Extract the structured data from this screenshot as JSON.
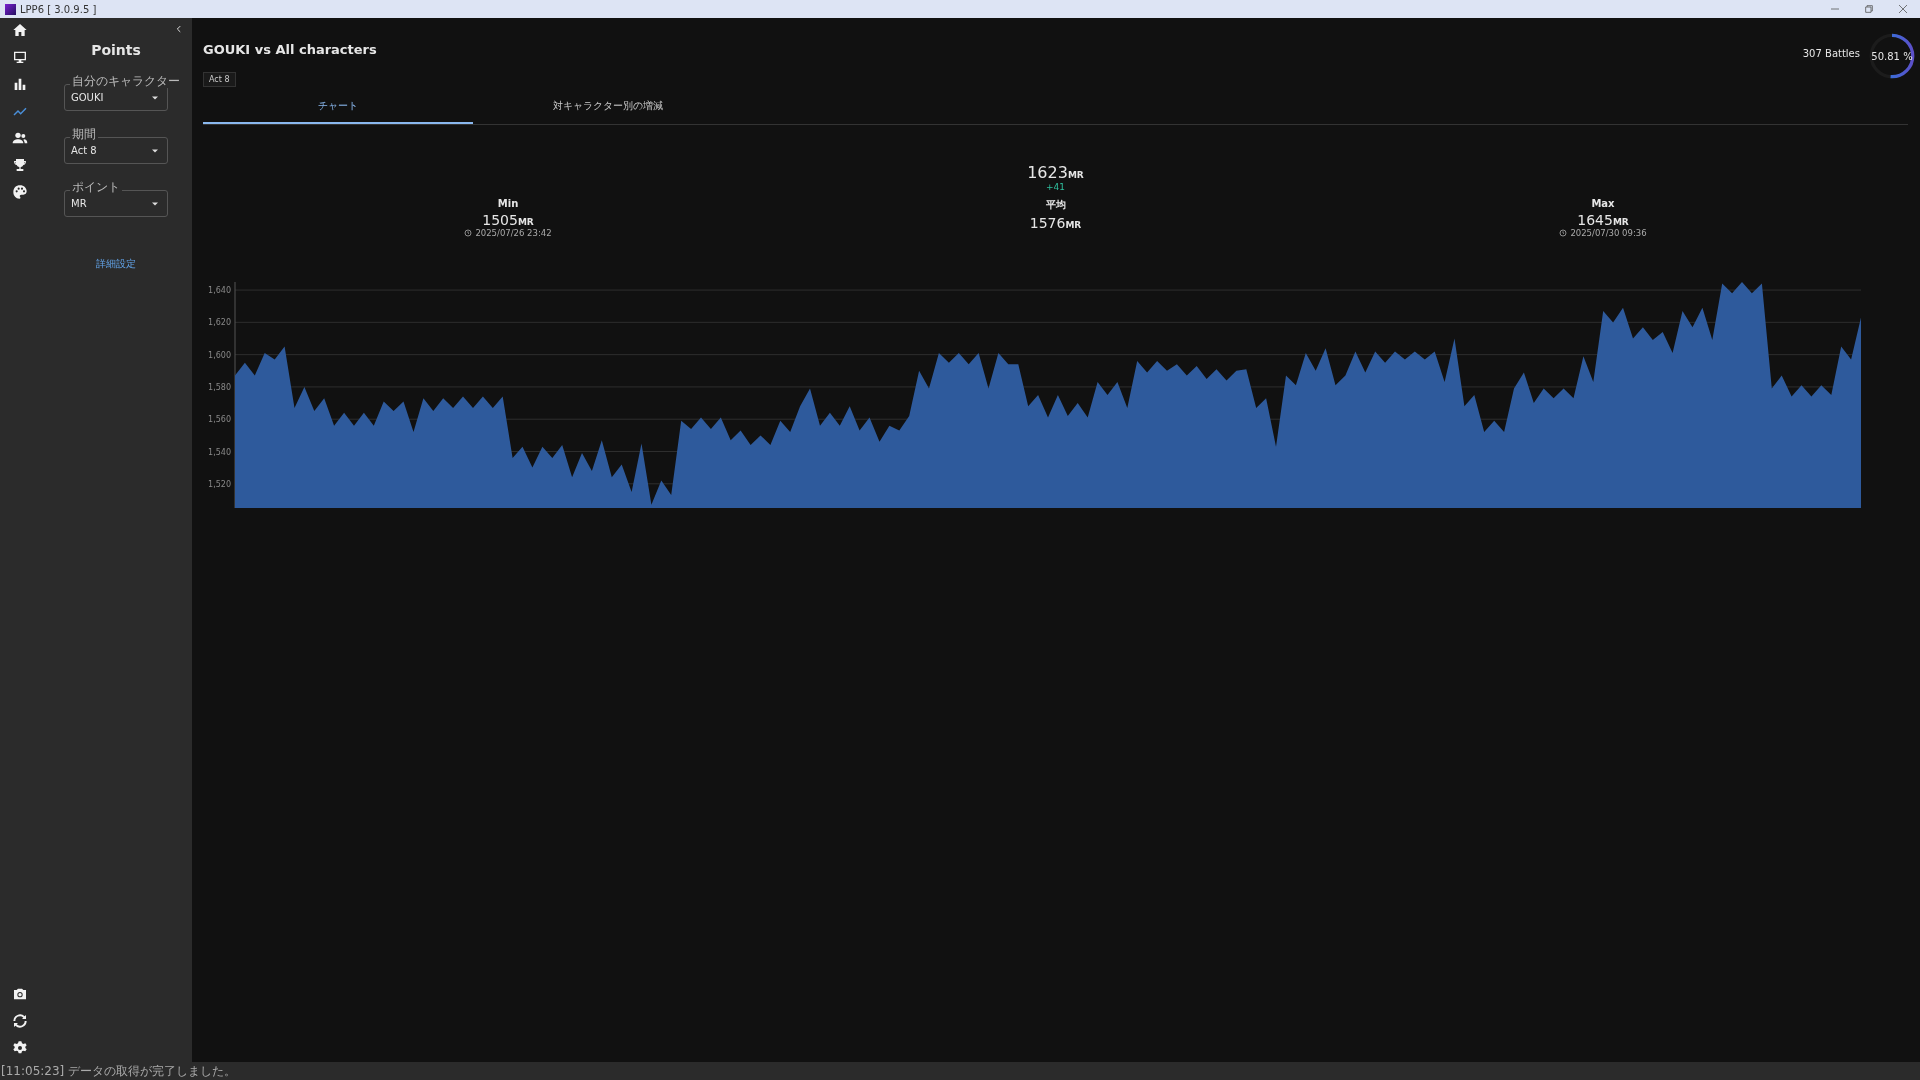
{
  "window": {
    "title": "LPP6 [ 3.0.9.5 ]"
  },
  "nav": [
    {
      "selected": false
    },
    {
      "selected": false
    },
    {
      "selected": false
    },
    {
      "selected": true
    },
    {
      "selected": false
    },
    {
      "selected": false
    },
    {
      "selected": false
    }
  ],
  "sidebar": {
    "title": "Points",
    "fields": [
      {
        "label": "自分のキャラクター",
        "value": "GOUKI"
      },
      {
        "label": "期間",
        "value": "Act 8"
      },
      {
        "label": "ポイント",
        "value": "MR"
      }
    ],
    "link": "詳細設定"
  },
  "header": {
    "title": "GOUKI vs All characters",
    "tag": "Act 8",
    "battles": "307 Battles",
    "win_rate": "50.81 %",
    "level": 0.5081
  },
  "tabs": [
    {
      "label": "チャート",
      "selected": true
    },
    {
      "label": "対キャラクター別の増減",
      "selected": false
    }
  ],
  "current": {
    "value": "1623",
    "unit": "MR",
    "change": "+41"
  },
  "stats": [
    {
      "label": "Min",
      "value": "1505",
      "unit": "MR",
      "time": "2025/07/26 23:42"
    },
    {
      "label": "平均",
      "value": "1576",
      "unit": "MR"
    },
    {
      "label": "Max",
      "value": "1645",
      "unit": "MR",
      "time": "2025/07/30 09:36"
    }
  ],
  "chart_data": {
    "type": "area",
    "grid": true,
    "ylim": [
      1505,
      1645
    ],
    "yticks": [
      {
        "value": 1520,
        "label": "1,520"
      },
      {
        "value": 1540,
        "label": "1,540"
      },
      {
        "value": 1560,
        "label": "1,560"
      },
      {
        "value": 1580,
        "label": "1,580"
      },
      {
        "value": 1600,
        "label": "1,600"
      },
      {
        "value": 1620,
        "label": "1,620"
      },
      {
        "value": 1640,
        "label": "1,640"
      }
    ],
    "series": [
      {
        "color": "#2e5a9c",
        "values": [
          1587,
          1595,
          1587,
          1601,
          1597,
          1605,
          1567,
          1580,
          1565,
          1573,
          1556,
          1564,
          1556,
          1564,
          1556,
          1571,
          1565,
          1571,
          1552,
          1573,
          1565,
          1573,
          1567,
          1574,
          1567,
          1574,
          1567,
          1574,
          1536,
          1543,
          1530,
          1543,
          1536,
          1544,
          1524,
          1539,
          1528,
          1547,
          1524,
          1532,
          1515,
          1545,
          1507,
          1522,
          1513,
          1559,
          1554,
          1561,
          1554,
          1561,
          1547,
          1553,
          1544,
          1550,
          1544,
          1559,
          1552,
          1568,
          1579,
          1556,
          1564,
          1556,
          1568,
          1553,
          1561,
          1546,
          1556,
          1553,
          1562,
          1590,
          1579,
          1601,
          1595,
          1601,
          1594,
          1601,
          1579,
          1601,
          1594,
          1594,
          1568,
          1575,
          1561,
          1575,
          1562,
          1570,
          1561,
          1583,
          1575,
          1583,
          1567,
          1596,
          1589,
          1596,
          1590,
          1594,
          1587,
          1593,
          1585,
          1591,
          1584,
          1590,
          1591,
          1567,
          1573,
          1543,
          1587,
          1581,
          1601,
          1590,
          1604,
          1581,
          1587,
          1602,
          1589,
          1602,
          1595,
          1602,
          1597,
          1602,
          1597,
          1602,
          1583,
          1610,
          1568,
          1575,
          1552,
          1559,
          1552,
          1579,
          1589,
          1570,
          1579,
          1573,
          1579,
          1573,
          1599,
          1583,
          1627,
          1620,
          1629,
          1610,
          1617,
          1609,
          1614,
          1601,
          1627,
          1617,
          1629,
          1609,
          1644,
          1638,
          1645,
          1638,
          1644,
          1579,
          1587,
          1574,
          1581,
          1574,
          1581,
          1575,
          1605,
          1597,
          1623
        ]
      }
    ]
  },
  "bottom_nav": [
    {
      "selected": false
    },
    {
      "selected": false
    },
    {
      "selected": false
    }
  ],
  "status_bar": "[11:05:23] データの取得が完了しました。"
}
